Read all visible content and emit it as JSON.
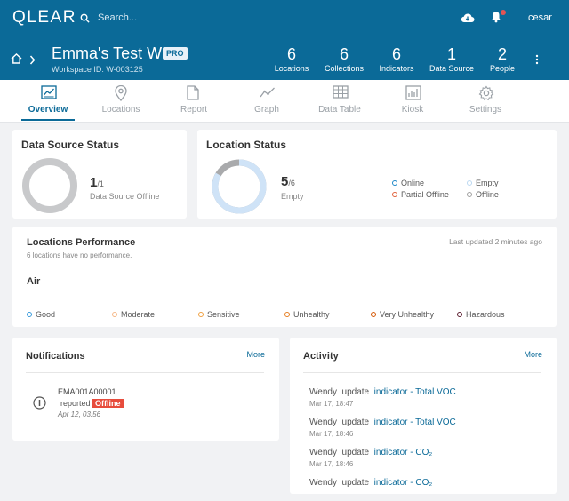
{
  "topbar": {
    "logo": "QLEAR",
    "search_placeholder": "Search...",
    "user_name": "cesar"
  },
  "workspace": {
    "title": "Emma's Test WS",
    "badge": "PRO",
    "id_text": "Workspace ID: W-003125",
    "stats": [
      {
        "value": "6",
        "label": "Locations"
      },
      {
        "value": "6",
        "label": "Collections"
      },
      {
        "value": "6",
        "label": "Indicators"
      },
      {
        "value": "1",
        "label": "Data Source"
      },
      {
        "value": "2",
        "label": "People"
      }
    ]
  },
  "tabs": [
    {
      "label": "Overview",
      "icon": "chart-icon",
      "active": true
    },
    {
      "label": "Locations",
      "icon": "location-pin-icon"
    },
    {
      "label": "Report",
      "icon": "document-icon"
    },
    {
      "label": "Graph",
      "icon": "line-graph-icon"
    },
    {
      "label": "Data Table",
      "icon": "table-icon"
    },
    {
      "label": "Kiosk",
      "icon": "kiosk-icon"
    },
    {
      "label": "Settings",
      "icon": "gear-icon"
    }
  ],
  "data_source_status": {
    "title": "Data Source Status",
    "count": "1",
    "total": "/1",
    "label": "Data Source Offline",
    "ring_color": "#c8c9cb"
  },
  "location_status": {
    "title": "Location Status",
    "count": "5",
    "total": "/6",
    "label": "Empty",
    "empty_fraction": 0.833,
    "legend": [
      {
        "label": "Online",
        "color": "#1e88c7"
      },
      {
        "label": "Empty",
        "color": "#bcd9f2"
      },
      {
        "label": "Partial Offline",
        "color": "#e0603a"
      },
      {
        "label": "Offline",
        "color": "#9e9e9e"
      }
    ]
  },
  "performance": {
    "title": "Locations Performance",
    "subtitle": "6 locations have no performance.",
    "updated": "Last updated 2 minutes ago",
    "section": "Air",
    "legend": [
      {
        "label": "Good",
        "color": "#3498db"
      },
      {
        "label": "Moderate",
        "color": "#f5b888"
      },
      {
        "label": "Sensitive",
        "color": "#f0a040"
      },
      {
        "label": "Unhealthy",
        "color": "#e67e22"
      },
      {
        "label": "Very Unhealthy",
        "color": "#d35400"
      },
      {
        "label": "Hazardous",
        "color": "#5b1c2e"
      }
    ]
  },
  "notifications": {
    "title": "Notifications",
    "more": "More",
    "items": [
      {
        "device": "EMA001A00001",
        "action": "reported",
        "status": "Offline",
        "time": "Apr 12, 03:56"
      }
    ]
  },
  "activity": {
    "title": "Activity",
    "more": "More",
    "items": [
      {
        "user": "Wendy",
        "verb": "update",
        "target": "indicator - Total VOC",
        "time": "Mar 17, 18:47"
      },
      {
        "user": "Wendy",
        "verb": "update",
        "target": "indicator - Total VOC",
        "time": "Mar 17, 18:46"
      },
      {
        "user": "Wendy",
        "verb": "update",
        "target": "indicator - CO₂",
        "time": "Mar 17, 18:46"
      },
      {
        "user": "Wendy",
        "verb": "update",
        "target": "indicator - CO₂",
        "time": ""
      }
    ]
  }
}
